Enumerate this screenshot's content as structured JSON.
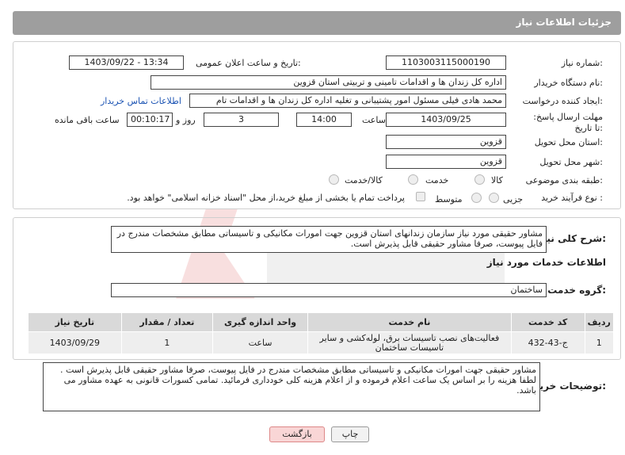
{
  "header": {
    "title": "جزئیات اطلاعات نیاز"
  },
  "fields": {
    "need_number_label": "شماره نیاز:",
    "need_number": "1103003115000190",
    "announce_label": "تاریخ و ساعت اعلان عمومی:",
    "announce_value": "1403/09/22 - 13:34",
    "buyer_org_label": "نام دستگاه خریدار:",
    "buyer_org": "اداره کل زندان ها و اقدامات تامینی و تربیتی استان قزوین",
    "creator_label": "ایجاد کننده درخواست:",
    "creator": "محمد هادی فیلی مسئول امور پشتیبانی و تغلیه اداره کل زندان ها و اقدامات تام",
    "contact_link": "اطلاعات تماس خریدار",
    "deadline_label": "مهلت ارسال پاسخ: تا تاریخ:",
    "deadline_date": "1403/09/25",
    "time_label": "ساعت",
    "deadline_time": "14:00",
    "days_value": "3",
    "days_label": "روز و",
    "remaining_time": "00:10:17",
    "remaining_label": "ساعت باقی مانده",
    "province_label": "استان محل تحویل:",
    "province": "قزوین",
    "city_label": "شهر محل تحویل:",
    "city": "قزوین",
    "category_label": "طبقه بندی موضوعی:",
    "cat_goods": "کالا",
    "cat_service": "خدمت",
    "cat_goods_service": "کالا/خدمت",
    "process_label": "نوع فرآیند خرید :",
    "proc_partial": "جزیی",
    "proc_medium": "متوسط",
    "payment_note": "پرداخت تمام یا بخشی از مبلغ خرید،از محل \"اسناد خزانه اسلامی\" خواهد بود."
  },
  "summary": {
    "label": "شرح کلی نیاز:",
    "text": "مشاور حقیقی مورد نیاز سازمان زندانهای استان قزوین جهت امورات مکانیکی و تاسیساتی مطابق مشخصات مندرج در فایل پیوست، صرفا مشاور حقیقی قابل پذیرش است."
  },
  "services": {
    "section_title": "اطلاعات خدمات مورد نیاز",
    "group_label": "گروه خدمت:",
    "group_value": "ساختمان",
    "columns": [
      "ردیف",
      "کد خدمت",
      "نام خدمت",
      "واحد اندازه گیری",
      "تعداد / مقدار",
      "تاریخ نیاز"
    ],
    "rows": [
      {
        "row": "1",
        "code": "ج-43-432",
        "name": "فعالیت‌های نصب تاسیسات برق، لوله‌کشی و سایر تاسیسات ساختمان",
        "unit": "ساعت",
        "qty": "1",
        "date": "1403/09/29"
      }
    ]
  },
  "buyer_notes": {
    "label": "توضیحات خریدار:",
    "text": "مشاور حقیقی جهت امورات مکانیکی و تاسیساتی مطابق مشخصات مندرج در فایل پیوست، صرفا مشاور حقیقی قابل پذیرش است . لطفا هزینه را بر اساس یک ساعت اعلام فرموده و از اعلام هزینه کلی خودداری فرمائید. تمامی کسورات قانونی به عهده مشاور می باشد."
  },
  "buttons": {
    "print": "چاپ",
    "back": "بازگشت"
  },
  "colors": {
    "header_bg": "#9e9e9e",
    "link": "#1b53b3",
    "back_btn_bg": "#f9d6d6"
  }
}
